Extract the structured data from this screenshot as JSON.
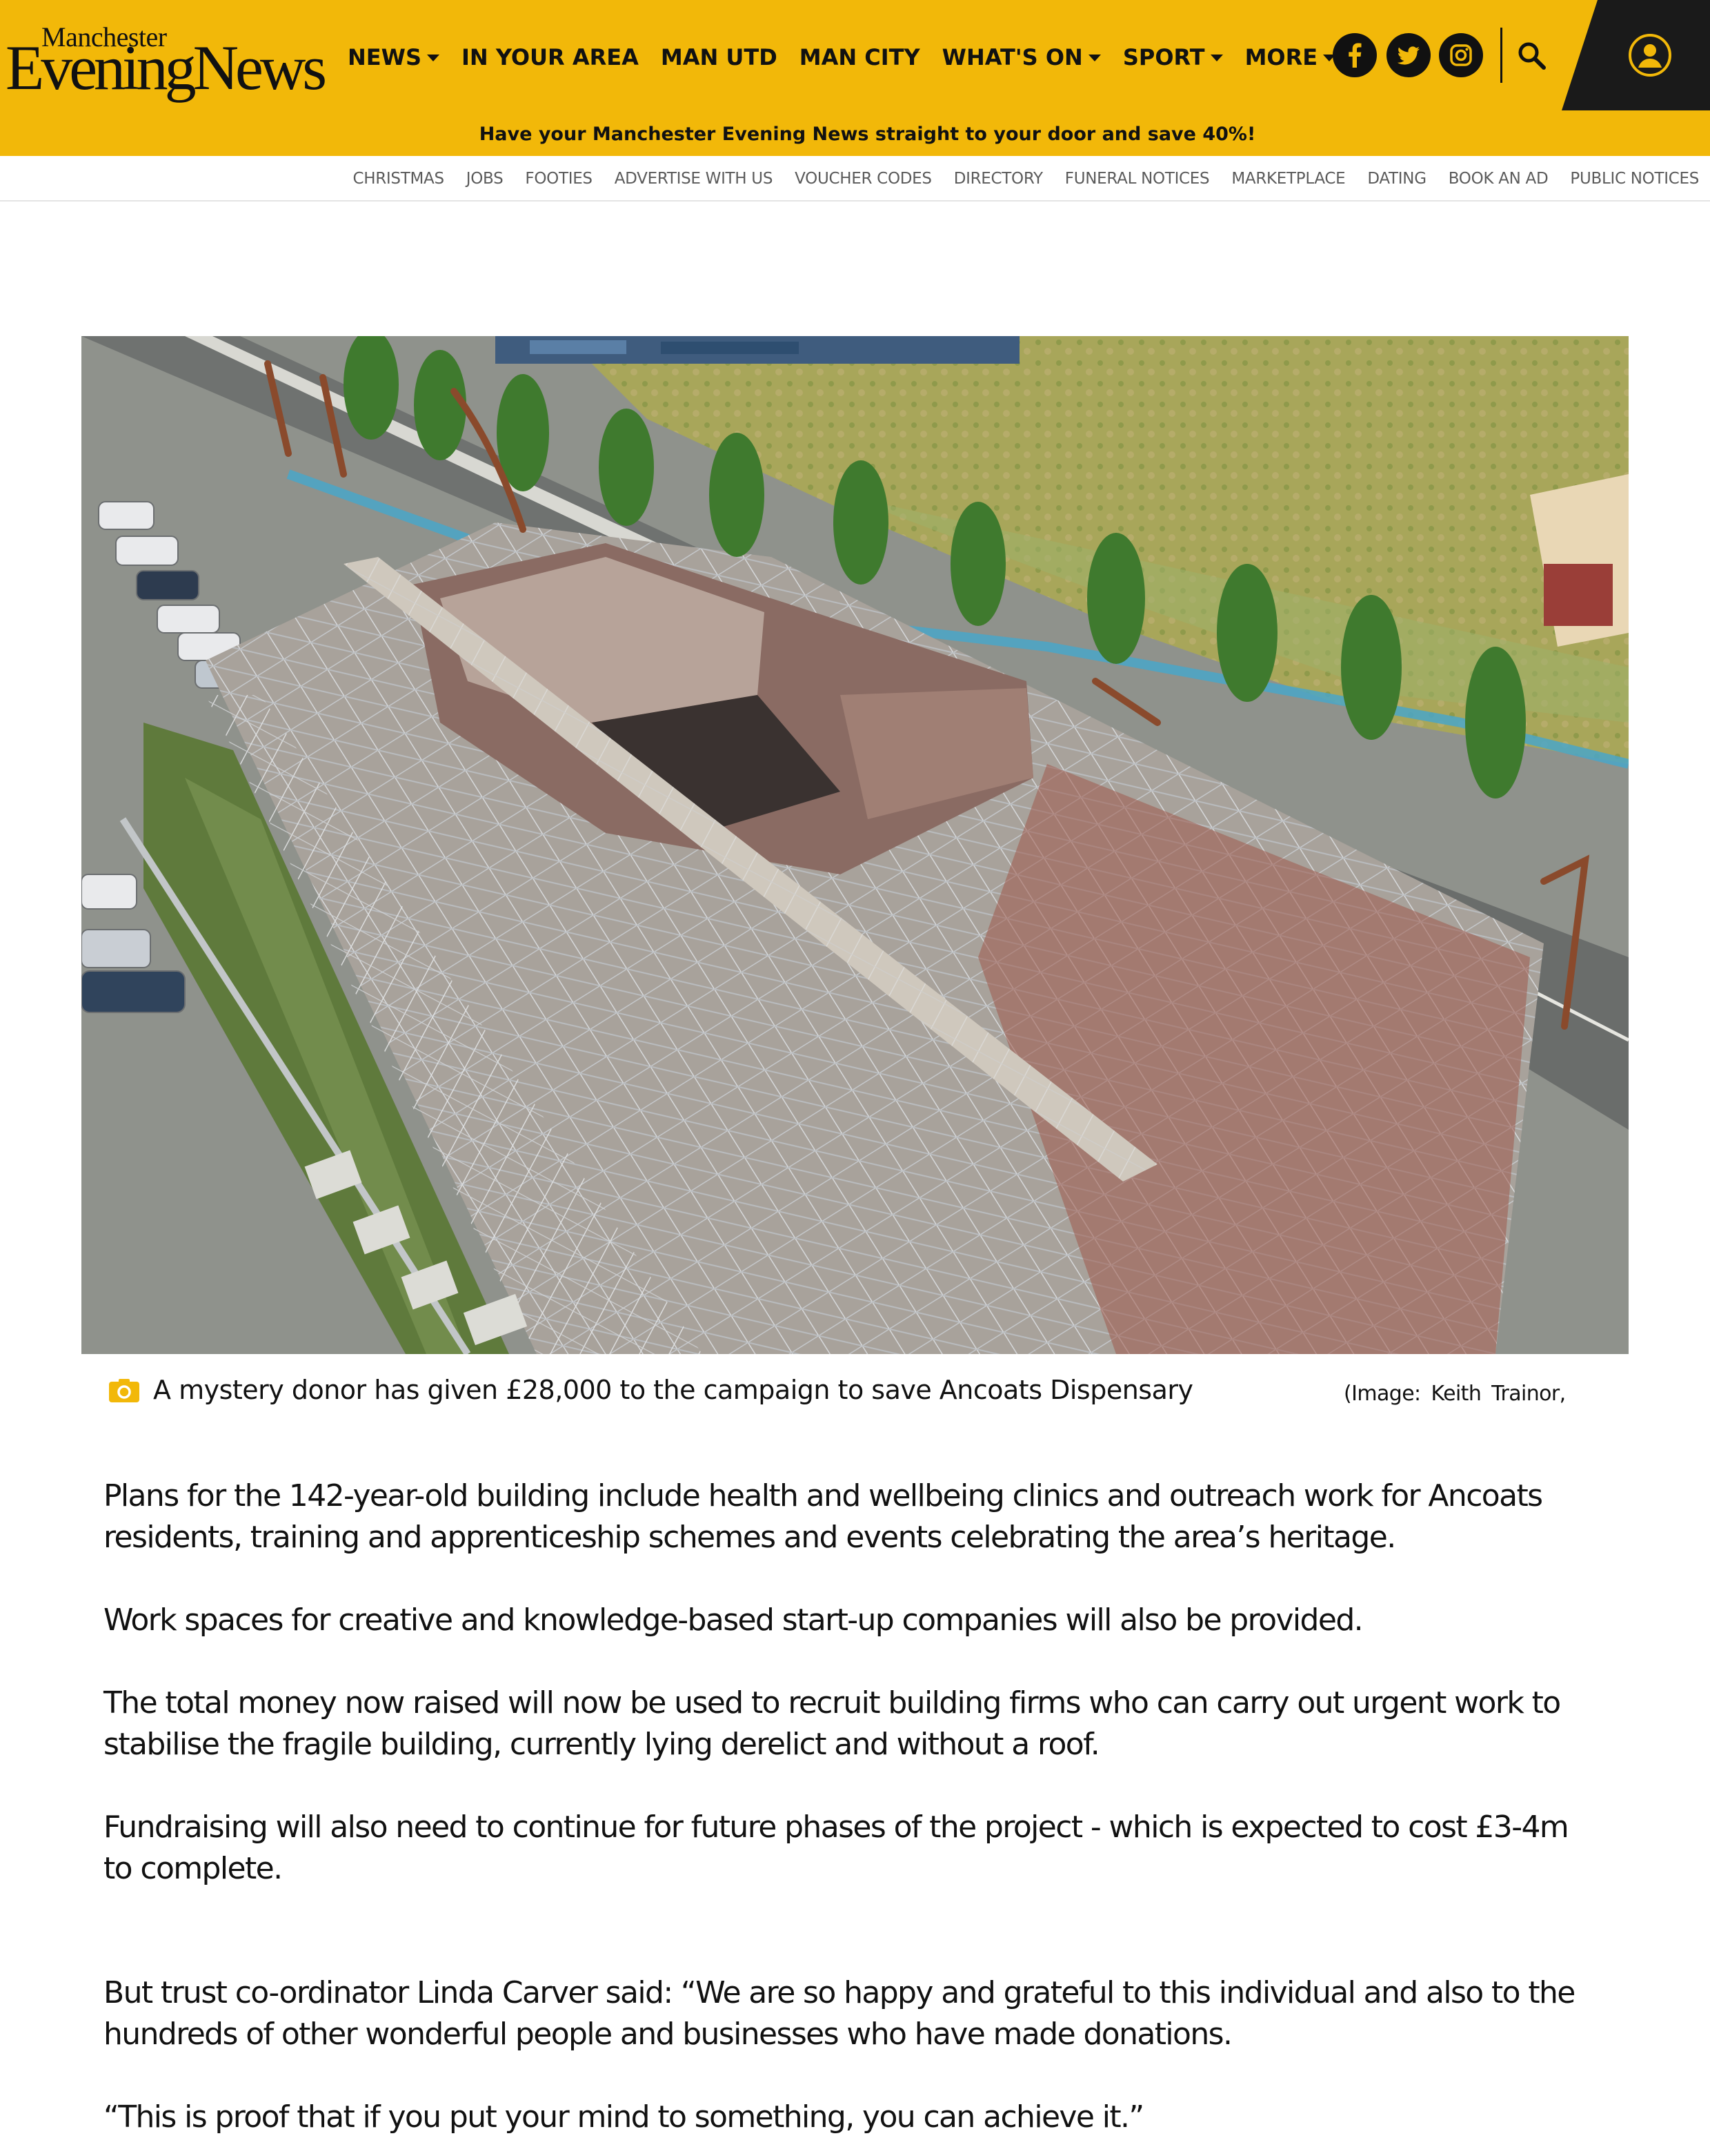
{
  "header": {
    "logo_small": "Manchester",
    "logo_big": "EveningNews",
    "nav": [
      {
        "label": "NEWS",
        "dropdown": true
      },
      {
        "label": "IN YOUR AREA",
        "dropdown": false
      },
      {
        "label": "MAN UTD",
        "dropdown": false
      },
      {
        "label": "MAN CITY",
        "dropdown": false
      },
      {
        "label": "WHAT'S ON",
        "dropdown": true
      },
      {
        "label": "SPORT",
        "dropdown": true
      },
      {
        "label": "MORE",
        "dropdown": true
      }
    ],
    "social_icons": [
      "facebook-icon",
      "twitter-icon",
      "instagram-icon"
    ],
    "search_icon": "search-icon",
    "account_icon": "user-account-icon",
    "promo": "Have your Manchester Evening News straight to your door and save 40%!"
  },
  "subnav": [
    "CHRISTMAS",
    "JOBS",
    "FOOTIES",
    "ADVERTISE WITH US",
    "VOUCHER CODES",
    "DIRECTORY",
    "FUNERAL NOTICES",
    "MARKETPLACE",
    "DATING",
    "BOOK AN AD",
    "PUBLIC NOTICES"
  ],
  "image": {
    "caption": "A mystery donor has given £28,000 to the campaign to save Ancoats Dispensary",
    "credit": "(Image:  Keith Trainor,",
    "caption_icon": "camera-icon"
  },
  "article": {
    "paragraphs": [
      [
        "Plans for the 142-year-old building include health and wellbeing clinics and outreach work for Ancoats",
        "residents, training and apprenticeship schemes and events celebrating the area’s heritage."
      ],
      [
        "Work spaces for creative and knowledge-based start-up companies will also be provided."
      ],
      [
        "The total money now raised will now be used to recruit building firms who can carry out urgent work to",
        "stabilise the fragile building, currently lying derelict and without a roof."
      ],
      [
        "Fundraising will also need to continue for future phases of the project - which is expected to cost £3-4m",
        "to complete."
      ],
      [
        "But trust co-ordinator Linda Carver said: “We are so happy and grateful to this individual and also to the",
        "hundreds of other wonderful people and businesses who have made donations."
      ],
      [
        "“This is proof that if you put your mind to something, you can achieve it.”"
      ]
    ]
  },
  "colors": {
    "header_yellow": "#f2b809",
    "account_panel": "#1a1a1a",
    "subnav_text": "#5b5b5b",
    "caption_icon": "#f2b809"
  }
}
